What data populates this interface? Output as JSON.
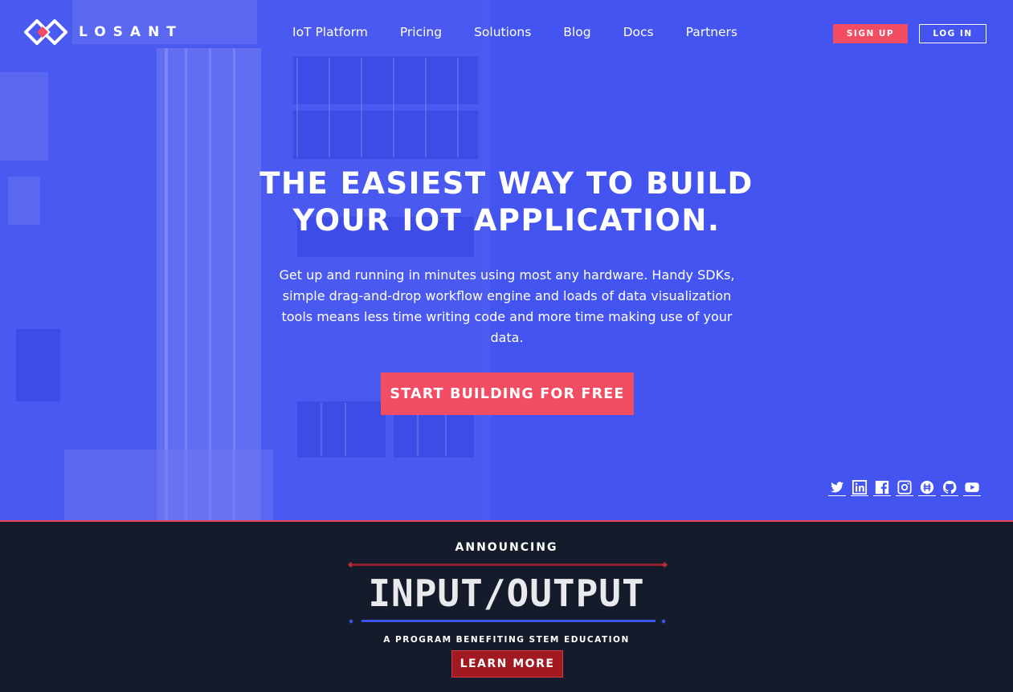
{
  "brand": {
    "logo_text": "LOSANT",
    "logo_icon": "losant-diamond-icon"
  },
  "nav": {
    "items": [
      {
        "label": "IoT Platform"
      },
      {
        "label": "Pricing"
      },
      {
        "label": "Solutions"
      },
      {
        "label": "Blog"
      },
      {
        "label": "Docs"
      },
      {
        "label": "Partners"
      }
    ],
    "signup_label": "SIGN UP",
    "login_label": "LOG IN"
  },
  "hero": {
    "headline_line1": "THE EASIEST WAY TO BUILD",
    "headline_line2": "YOUR IOT APPLICATION.",
    "subtext": "Get up and running in minutes using most any hardware. Handy SDKs, simple drag-and-drop workflow engine and loads of data visualization tools means less time writing code and more time making use of your data.",
    "cta_label": "START BUILDING FOR FREE"
  },
  "social": [
    "twitter-icon",
    "linkedin-icon",
    "facebook-icon",
    "instagram-icon",
    "hackster-icon",
    "github-icon",
    "youtube-icon"
  ],
  "announcement": {
    "kicker": "ANNOUNCING",
    "title": "INPUT/OUTPUT",
    "subtitle": "A PROGRAM BENEFITING STEM EDUCATION",
    "button_label": "LEARN MORE"
  },
  "colors": {
    "hero_blue": "#4455ef",
    "accent_red": "#f34d64",
    "dark_navy": "#141b2a",
    "learn_more_red": "#a11a22"
  }
}
